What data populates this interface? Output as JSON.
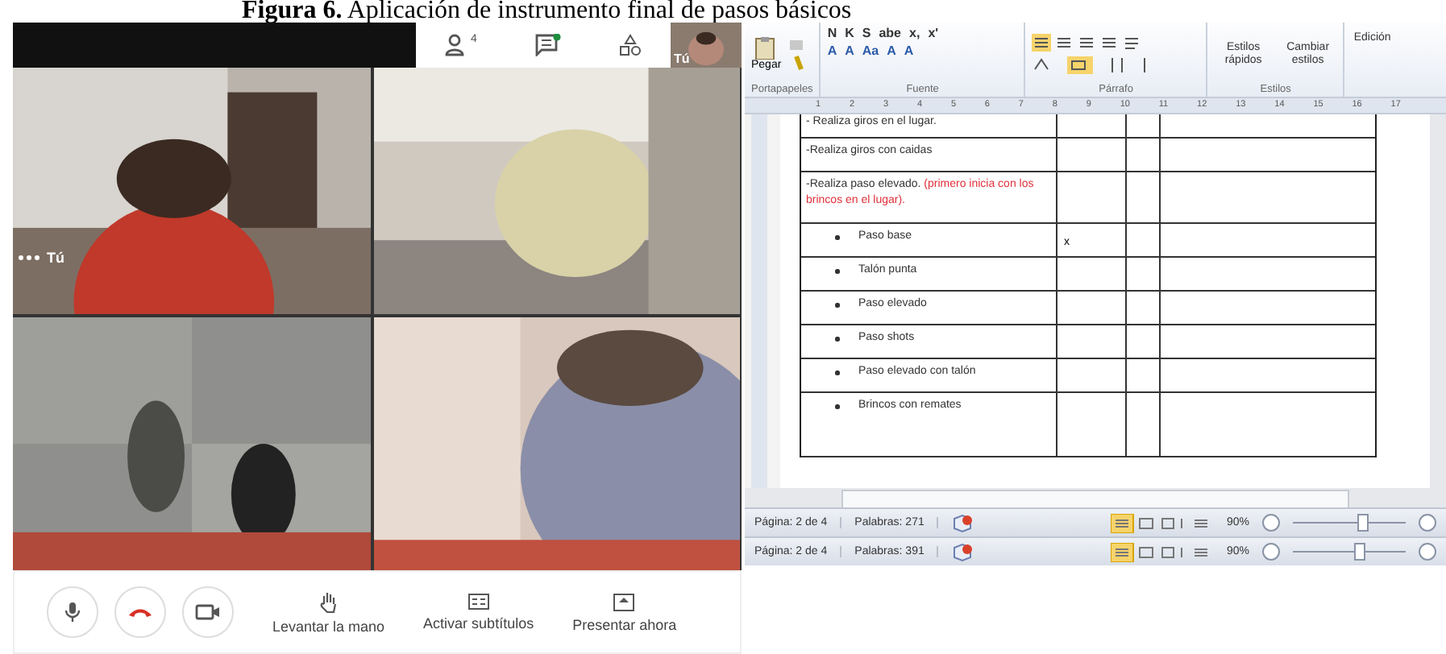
{
  "caption": {
    "label": "Figura 6.",
    "text": "Aplicación de instrumento final de pasos básicos"
  },
  "meet": {
    "toolbar": [
      {
        "kind": "people",
        "badge": "4"
      },
      {
        "kind": "chat",
        "unread": true
      },
      {
        "kind": "shapes"
      }
    ],
    "self_view": {
      "label": "Tú"
    },
    "tiles": [
      {
        "kind": "picture",
        "label": "Tú"
      },
      {
        "kind": "picture"
      },
      {
        "kind": "picture"
      },
      {
        "kind": "picture"
      }
    ],
    "controls": [
      {
        "kind": "mic"
      },
      {
        "kind": "hangup"
      },
      {
        "kind": "camera"
      }
    ],
    "actions": [
      {
        "kind": "hand",
        "label": "Levantar la mano"
      },
      {
        "kind": "cc",
        "label": "Activar subtítulos"
      },
      {
        "kind": "present",
        "label": "Presentar ahora"
      }
    ]
  },
  "word": {
    "ribbon": {
      "paste": "Pegar",
      "font_row_1": [
        "N",
        "K",
        "S",
        "abe",
        "x,",
        "x'"
      ],
      "font_row_2": [
        "A",
        "A",
        "Aa",
        "A",
        "A"
      ],
      "groups": [
        "Portapapeles",
        "Fuente",
        "Párrafo",
        "Estilos"
      ],
      "styles": [
        "Estilos rápidos",
        "Cambiar estilos"
      ],
      "editing": "Edición"
    },
    "ruler": [
      "1",
      "2",
      "3",
      "4",
      "5",
      "6",
      "7",
      "8",
      "9",
      "10",
      "11",
      "12",
      "13",
      "14",
      "15",
      "16",
      "17"
    ],
    "table": {
      "rows": [
        {
          "kind": "text",
          "text": "- Realiza giros en el lugar."
        },
        {
          "kind": "text",
          "text": "-Realiza giros con caidas"
        },
        {
          "kind": "text",
          "text": "-Realiza paso elevado.",
          "note": "(primero inicia con los brincos en el lugar)."
        },
        {
          "kind": "bullet",
          "text": "Paso base",
          "mark": "x"
        },
        {
          "kind": "bullet",
          "text": "Talón punta"
        },
        {
          "kind": "bullet",
          "text": "Paso elevado"
        },
        {
          "kind": "bullet",
          "text": "Paso shots"
        },
        {
          "kind": "bullet",
          "text": "Paso elevado con talón"
        },
        {
          "kind": "bullet",
          "text": "Brincos con remates"
        }
      ]
    },
    "status_bars": [
      {
        "page": "Página: 2 de 4",
        "words": "Palabras: 271",
        "zoom": "90%",
        "level": 0.62
      },
      {
        "page": "Página: 2 de 4",
        "words": "Palabras: 391",
        "zoom": "90%",
        "level": 0.58
      }
    ]
  }
}
